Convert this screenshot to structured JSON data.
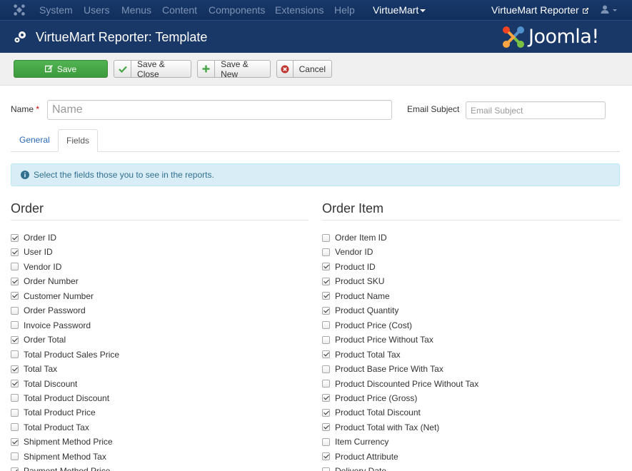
{
  "nav": {
    "items": [
      "System",
      "Users",
      "Menus",
      "Content",
      "Components",
      "Extensions",
      "Help"
    ],
    "active": "VirtueMart",
    "site_link": "VirtueMart Reporter"
  },
  "header": {
    "title": "VirtueMart Reporter: Template",
    "brand": "Joomla!"
  },
  "toolbar": {
    "save": "Save",
    "save_close": "Save & Close",
    "save_new": "Save & New",
    "cancel": "Cancel"
  },
  "form": {
    "name_label": "Name",
    "name_required": "*",
    "name_placeholder": "Name",
    "email_label": "Email Subject",
    "email_placeholder": "Email Subject"
  },
  "tabs": [
    "General",
    "Fields"
  ],
  "alert": "Select the fields those you to see in the reports.",
  "order": {
    "title": "Order",
    "fields": [
      {
        "label": "Order ID",
        "checked": true
      },
      {
        "label": "User ID",
        "checked": true
      },
      {
        "label": "Vendor ID",
        "checked": false
      },
      {
        "label": "Order Number",
        "checked": true
      },
      {
        "label": "Customer Number",
        "checked": true
      },
      {
        "label": "Order Password",
        "checked": false
      },
      {
        "label": "Invoice Password",
        "checked": false
      },
      {
        "label": "Order Total",
        "checked": true
      },
      {
        "label": "Total Product Sales Price",
        "checked": false
      },
      {
        "label": "Total Tax",
        "checked": true
      },
      {
        "label": "Total Discount",
        "checked": true
      },
      {
        "label": "Total Product Discount",
        "checked": false
      },
      {
        "label": "Total Product Price",
        "checked": false
      },
      {
        "label": "Total Product Tax",
        "checked": false
      },
      {
        "label": "Shipment Method Price",
        "checked": true
      },
      {
        "label": "Shipment Method Tax",
        "checked": false
      },
      {
        "label": "Payment Method Price",
        "checked": true
      }
    ]
  },
  "order_item": {
    "title": "Order Item",
    "fields": [
      {
        "label": "Order Item ID",
        "checked": false
      },
      {
        "label": "Vendor ID",
        "checked": false
      },
      {
        "label": "Product ID",
        "checked": true
      },
      {
        "label": "Product SKU",
        "checked": true
      },
      {
        "label": "Product Name",
        "checked": true
      },
      {
        "label": "Product Quantity",
        "checked": true
      },
      {
        "label": "Product Price (Cost)",
        "checked": false
      },
      {
        "label": "Product Price Without Tax",
        "checked": false
      },
      {
        "label": "Product Total Tax",
        "checked": true
      },
      {
        "label": "Product Base Price With Tax",
        "checked": false
      },
      {
        "label": "Product Discounted Price Without Tax",
        "checked": false
      },
      {
        "label": "Product Price (Gross)",
        "checked": true
      },
      {
        "label": "Product Total Discount",
        "checked": true
      },
      {
        "label": "Product Total with Tax (Net)",
        "checked": true
      },
      {
        "label": "Item Currency",
        "checked": false
      },
      {
        "label": "Product Attribute",
        "checked": true
      },
      {
        "label": "Delivery Date",
        "checked": false
      }
    ]
  },
  "colors": {
    "navbar": "#17386a",
    "header": "#1a3867",
    "save_green": "#46a546",
    "link_blue": "#2a69b8",
    "alert_bg": "#d9edf7"
  }
}
